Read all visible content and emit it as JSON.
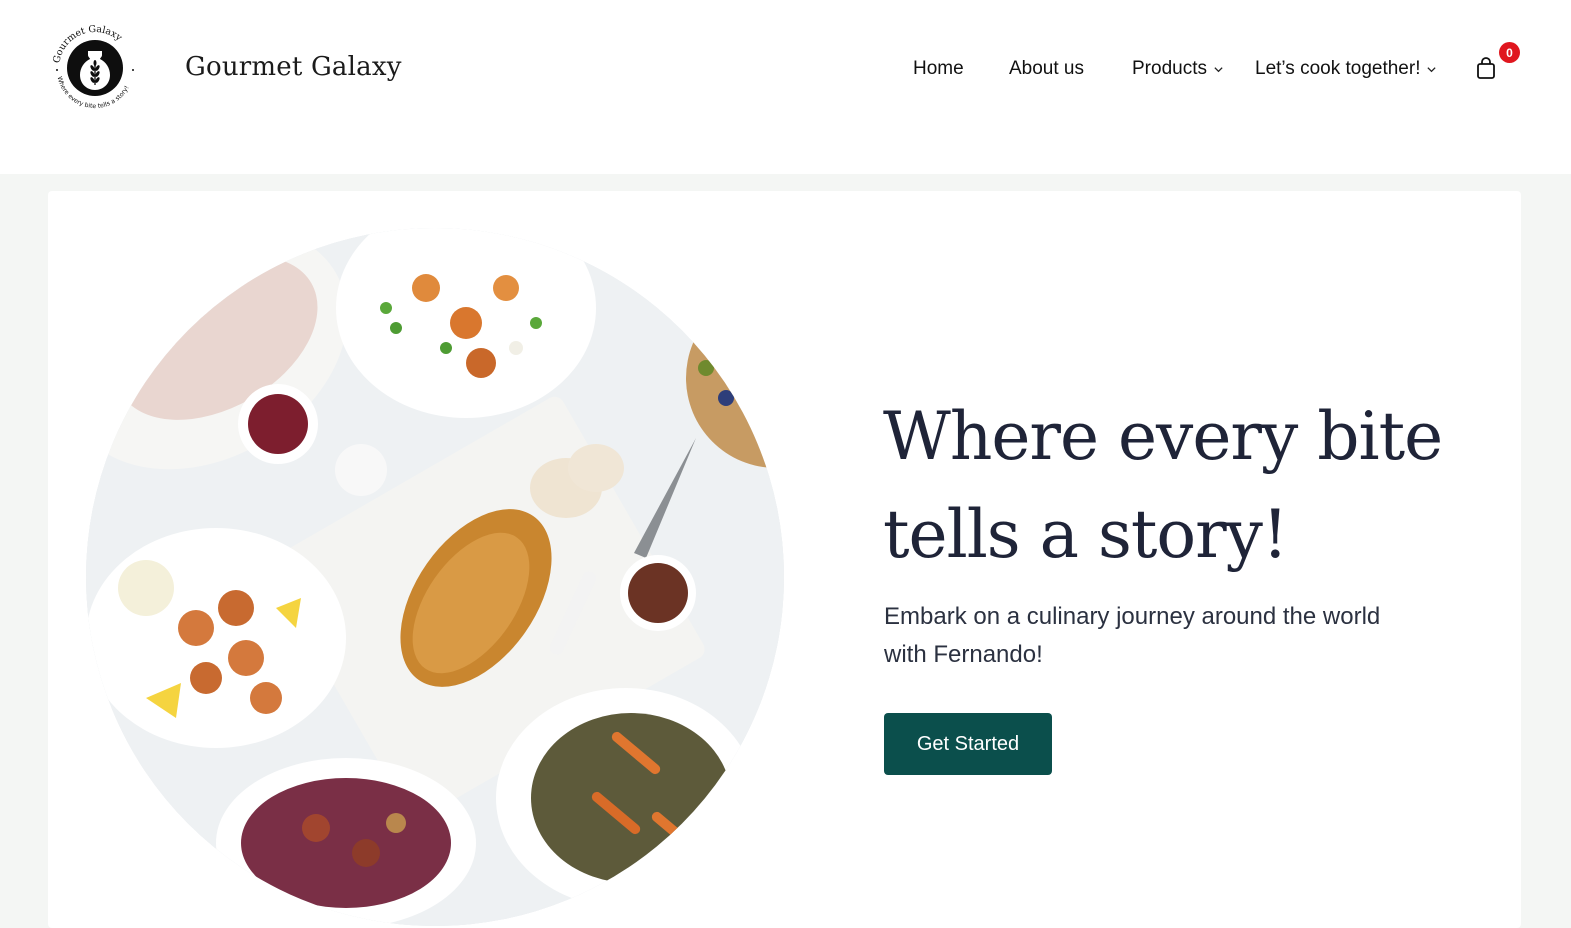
{
  "header": {
    "brand_name": "Gourmet Galaxy",
    "logo": {
      "ring_text_top": "Gourmet Galaxy",
      "ring_text_bottom": "Where every bite tells a story!",
      "icon": "vase-wheat-icon"
    },
    "nav": {
      "home": "Home",
      "about": "About us",
      "products": "Products",
      "cook_together": "Let’s cook together!"
    },
    "cart": {
      "icon": "shopping-bag-icon",
      "count": "0"
    }
  },
  "hero": {
    "title_line1": "Where every bite",
    "title_line2": "tells a story!",
    "subtitle": "Embark on a culinary journey around the world with Fernando!",
    "cta_label": "Get Started",
    "image_subject": "food-spread-photo"
  },
  "colors": {
    "accent": "#0b4f4c",
    "badge": "#e0161e",
    "page_bg": "#f4f6f4",
    "title": "#1f2438"
  }
}
